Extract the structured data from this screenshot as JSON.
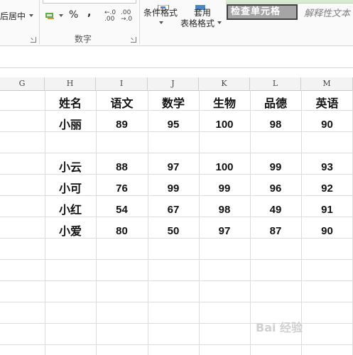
{
  "ribbon": {
    "merge_label": "后居中",
    "number_group_label": "数字",
    "percent_symbol": "%",
    "comma_symbol": ",",
    "increase_decimal": "←.0 .00",
    "decrease_decimal": ".00 →.0",
    "conditional_format_label": "条件格式",
    "table_format_label_1": "套用",
    "table_format_label_2": "表格格式",
    "style_check_cell": "检查单元格",
    "style_explanatory": "解释性文本"
  },
  "columns": [
    "G",
    "H",
    "I",
    "J",
    "K",
    "L",
    "M"
  ],
  "table": {
    "headers": [
      "姓名",
      "语文",
      "数学",
      "生物",
      "品德",
      "英语"
    ],
    "rows": [
      [
        "小丽",
        "89",
        "95",
        "100",
        "98",
        "90"
      ],
      [
        "",
        "",
        "",
        "",
        "",
        ""
      ],
      [
        "小云",
        "88",
        "97",
        "100",
        "99",
        "93"
      ],
      [
        "小可",
        "76",
        "99",
        "99",
        "96",
        "92"
      ],
      [
        "小红",
        "54",
        "67",
        "98",
        "49",
        "91"
      ],
      [
        "小爱",
        "80",
        "50",
        "97",
        "87",
        "90"
      ]
    ]
  },
  "watermark": "Bai 经验"
}
